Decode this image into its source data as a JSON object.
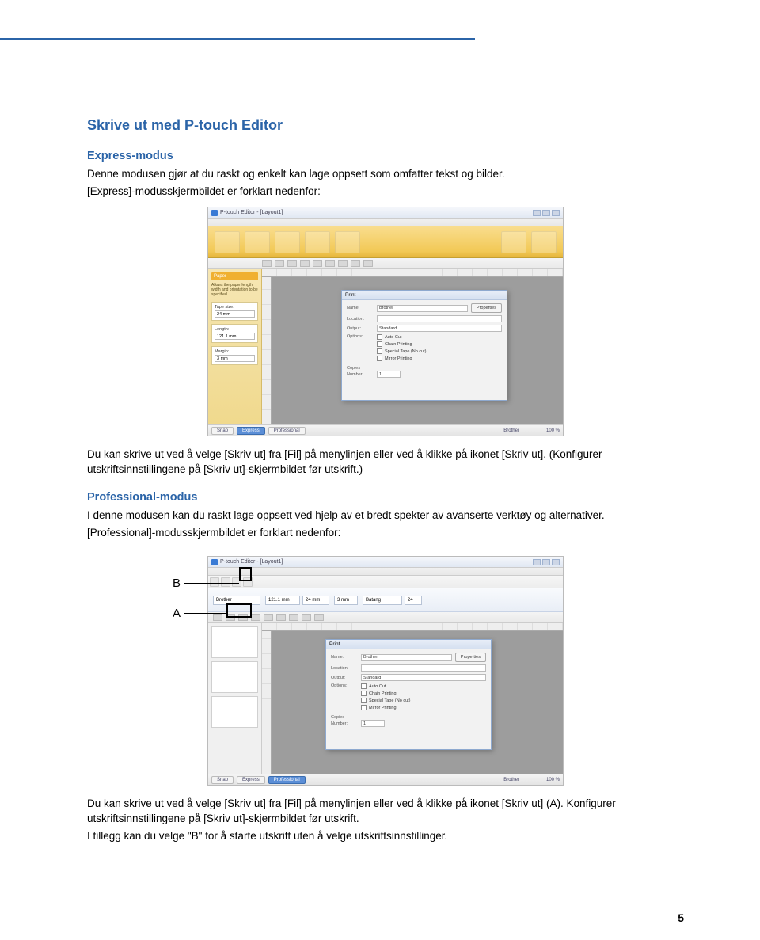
{
  "header_rule": true,
  "title": "Skrive ut med P-touch Editor",
  "express": {
    "heading": "Express-modus",
    "p1": "Denne modusen gjør at du raskt og enkelt kan lage oppsett som omfatter tekst og bilder.",
    "p2": "[Express]-modusskjermbildet er forklart nedenfor:",
    "after1": "Du kan skrive ut ved å velge [Skriv ut] fra [Fil] på menylinjen eller ved å klikke på ikonet [Skriv ut]. (Konfigurer utskriftsinnstillingene på [Skriv ut]-skjermbildet før utskrift.)"
  },
  "professional": {
    "heading": "Professional-modus",
    "p1": "I denne modusen kan du raskt lage oppsett ved hjelp av et bredt spekter av avanserte verktøy og alternativer.",
    "p2": "[Professional]-modusskjermbildet er forklart nedenfor:",
    "after1": "Du kan skrive ut ved å velge [Skriv ut] fra [Fil] på menylinjen eller ved å klikke på ikonet [Skriv ut] (A). Konfigurer utskriftsinnstillingene på [Skriv ut]-skjermbildet før utskrift.",
    "after2": "I tillegg kan du velge \"B\" for å starte utskrift uten å velge utskriftsinnstillinger."
  },
  "screenshot_common": {
    "app_title": "P-touch Editor - [Layout1]",
    "footer_snap": "Snap",
    "footer_express": "Express",
    "footer_professional": "Professional",
    "footer_printer": "Brother",
    "footer_zoom": "100 %"
  },
  "express_shot": {
    "sidebar_heading": "Paper",
    "sidebar_hint": "Allows the paper length, width and orientation to be specified.",
    "tape_size_label": "Tape size:",
    "tape_size_value": "24 mm",
    "length_label": "Length:",
    "length_value": "121.1 mm",
    "margin_label": "Margin:",
    "margin_value": "3 mm"
  },
  "pro_shot": {
    "printer_label": "Brother",
    "length_value": "121.1 mm",
    "width_value": "24 mm",
    "margin_value": "3 mm",
    "font_value": "Batang",
    "font_size": "24"
  },
  "dialog": {
    "title": "Print",
    "printer_label": "Name:",
    "printer_value": "Brother",
    "properties_btn": "Properties",
    "location_label": "Location:",
    "output_label": "Output:",
    "output_value": "Standard",
    "options_label": "Options:",
    "opt1": "Auto Cut",
    "opt2": "Chain Printing",
    "opt3": "Special Tape (No cut)",
    "opt4": "Mirror Printing",
    "copies_label": "Copies",
    "number_label": "Number:",
    "number_value": "1"
  },
  "callouts": {
    "a": "A",
    "b": "B"
  },
  "page_number": "5"
}
